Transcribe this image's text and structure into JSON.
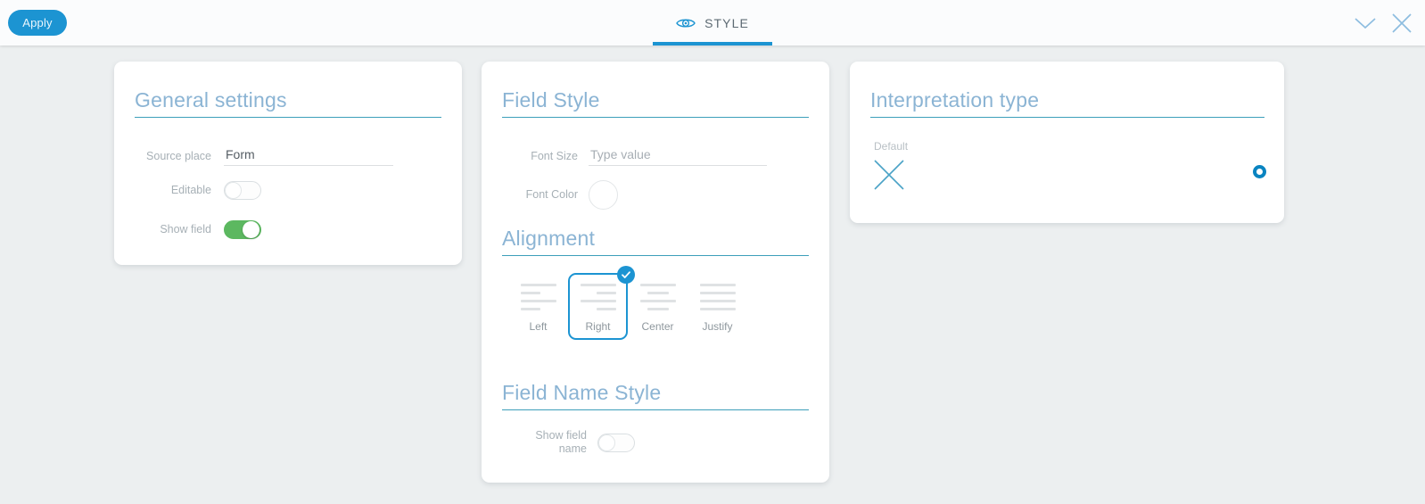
{
  "header": {
    "apply_label": "Apply",
    "tab": {
      "label": "STYLE",
      "icon": "eye-icon",
      "active": true
    },
    "collapse_icon": "chevron-down-icon",
    "close_icon": "close-icon",
    "accent_color": "#1c94d2"
  },
  "general_settings": {
    "title": "General settings",
    "source_place": {
      "label": "Source place",
      "value": "Form"
    },
    "editable": {
      "label": "Editable",
      "state": "off"
    },
    "show_field": {
      "label": "Show field",
      "state": "on",
      "on_color": "#5cb860"
    }
  },
  "field_style": {
    "title": "Field Style",
    "font_size": {
      "label": "Font Size",
      "value": "",
      "placeholder": "Type value"
    },
    "font_color": {
      "label": "Font Color",
      "swatch": "#ffffff"
    },
    "alignment": {
      "title": "Alignment",
      "selected": "Right",
      "options": [
        {
          "label": "Left",
          "lines": [
            100,
            55,
            100,
            55
          ]
        },
        {
          "label": "Right",
          "lines": [
            100,
            55,
            100,
            55
          ]
        },
        {
          "label": "Center",
          "lines": [
            100,
            60,
            100,
            60
          ]
        },
        {
          "label": "Justify",
          "lines": [
            100,
            100,
            100,
            100
          ]
        }
      ]
    },
    "field_name_style": {
      "title": "Field Name Style",
      "show_field_name": {
        "label_line1": "Show field",
        "label_line2": "name",
        "state": "off"
      }
    }
  },
  "interpretation_type": {
    "title": "Interpretation type",
    "default_option": {
      "label": "Default",
      "icon": "close-x-icon"
    },
    "radio": {
      "selected": true,
      "color": "#0a84c1"
    }
  }
}
